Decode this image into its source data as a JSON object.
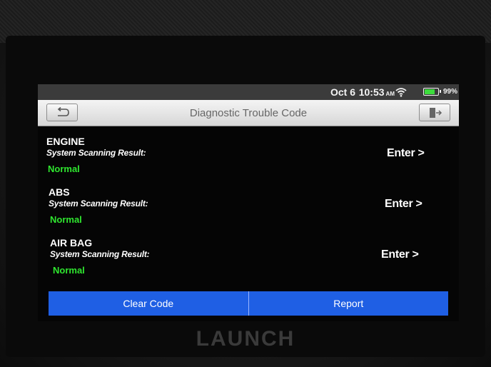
{
  "status": {
    "date": "Oct 6",
    "time": "10:53",
    "ampm": "AM",
    "battery": "99%"
  },
  "header": {
    "title": "Diagnostic Trouble Code"
  },
  "systems": [
    {
      "name": "ENGINE",
      "label": "System Scanning Result:",
      "value": "Normal",
      "action": "Enter >"
    },
    {
      "name": "ABS",
      "label": "System Scanning Result:",
      "value": "Normal",
      "action": "Enter >"
    },
    {
      "name": "AIR BAG",
      "label": "System Scanning Result:",
      "value": "Normal",
      "action": "Enter >"
    }
  ],
  "footer": {
    "clear_label": "Clear Code",
    "report_label": "Report"
  },
  "device": {
    "brand": "LAUNCH"
  },
  "colors": {
    "normal": "#2fe62f",
    "button_blue": "#1f5fe4"
  }
}
